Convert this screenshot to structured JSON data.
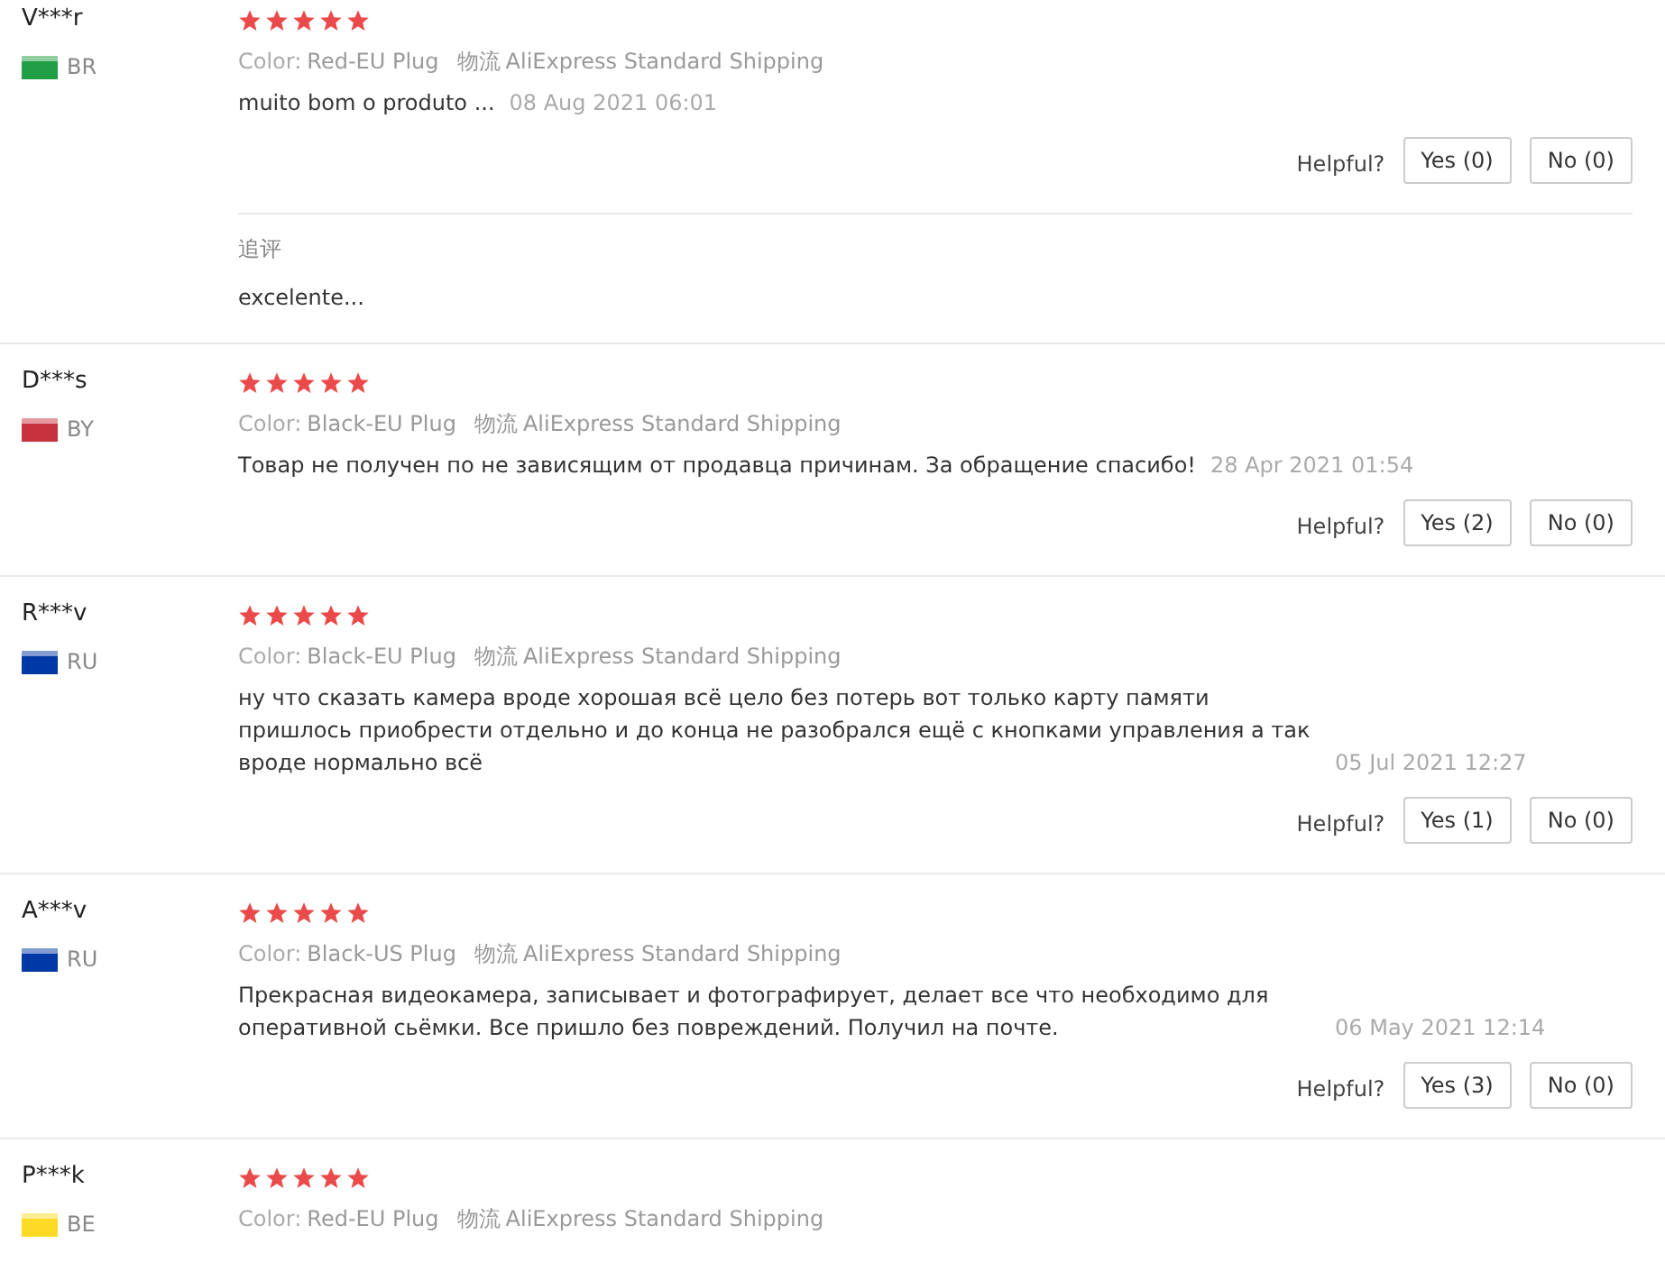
{
  "reviews": [
    {
      "name": "V***r",
      "country": "BR",
      "color": "#229e45",
      "stars": 5,
      "color_label": "Color:",
      "color_value": "Red-EU Plug",
      "shipping_label": "物流",
      "shipping_value": "AliExpress Standard Shipping",
      "text": "muito bom o produto ...",
      "date": "08 Aug 2021 06:01",
      "helpful_label": "Helpful?",
      "yes": "Yes (0)",
      "no": "No (0)",
      "followup": {
        "label": "追评",
        "text": "excelente..."
      }
    },
    {
      "name": "D***s",
      "country": "BY",
      "color": "#c8313e",
      "stars": 5,
      "color_label": "Color:",
      "color_value": "Black-EU Plug",
      "shipping_label": "物流",
      "shipping_value": "AliExpress Standard Shipping",
      "text": "Товар не получен по не зависящим от продавца причинам. За обращение спасибо!",
      "date": "28 Apr 2021 01:54",
      "helpful_label": "Helpful?",
      "yes": "Yes (2)",
      "no": "No (0)"
    },
    {
      "name": "R***v",
      "country": "RU",
      "color": "#0039a6",
      "stars": 5,
      "color_label": "Color:",
      "color_value": "Black-EU Plug",
      "shipping_label": "物流",
      "shipping_value": "AliExpress Standard Shipping",
      "text": "ну что сказать камера вроде хорошая всё цело без потерь вот только карту памяти пришлось приобрести отдельно и до конца не разобрался ещё с кнопками управления а так вроде нормально всё",
      "date": "05 Jul 2021 12:27",
      "helpful_label": "Helpful?",
      "yes": "Yes (1)",
      "no": "No (0)"
    },
    {
      "name": "A***v",
      "country": "RU",
      "color": "#0039a6",
      "stars": 5,
      "color_label": "Color:",
      "color_value": "Black-US Plug",
      "shipping_label": "物流",
      "shipping_value": "AliExpress Standard Shipping",
      "text": "Прекрасная видеокамера, записывает и фотографирует, делает все что необходимо для оперативной сьёмки. Все пришло без повреждений. Получил на почте.",
      "date": "06 May 2021 12:14",
      "helpful_label": "Helpful?",
      "yes": "Yes (3)",
      "no": "No (0)"
    },
    {
      "name": "P***k",
      "country": "BE",
      "color": "#fdda24",
      "stars": 5,
      "color_label": "Color:",
      "color_value": "Red-EU Plug",
      "shipping_label": "物流",
      "shipping_value": "AliExpress Standard Shipping"
    }
  ]
}
